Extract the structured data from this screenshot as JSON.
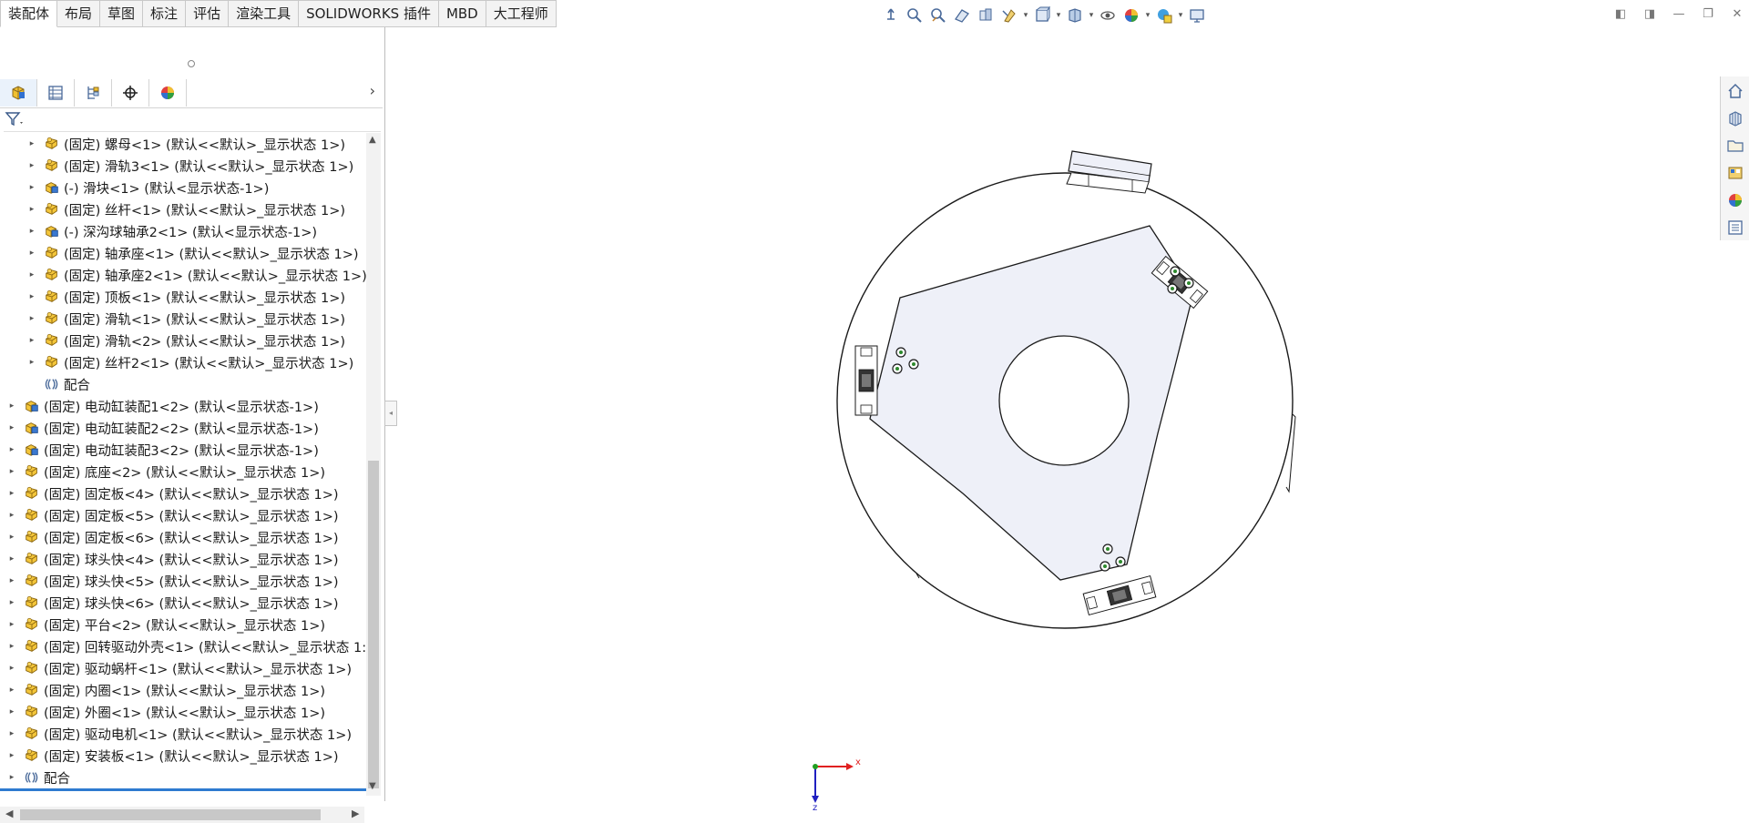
{
  "command_tabs": [
    {
      "label": "装配体",
      "active": true
    },
    {
      "label": "布局",
      "active": false
    },
    {
      "label": "草图",
      "active": false
    },
    {
      "label": "标注",
      "active": false
    },
    {
      "label": "评估",
      "active": false
    },
    {
      "label": "渲染工具",
      "active": false
    },
    {
      "label": "SOLIDWORKS 插件",
      "active": false
    },
    {
      "label": "MBD",
      "active": false
    },
    {
      "label": "大工程师",
      "active": false
    }
  ],
  "headsup_icons": [
    "zoom-to-fit-icon",
    "zoom-to-area-icon",
    "previous-view-icon",
    "section-view-icon",
    "dynamic-annotation-icon",
    "view-orientation-icon",
    "display-style-icon",
    "hide-show-items-icon",
    "edit-appearance-icon",
    "apply-scene-icon",
    "view-settings-icon",
    "display-pane-icon"
  ],
  "feature_manager": {
    "tabs": [
      "feature-manager-tab",
      "property-manager-tab",
      "configuration-manager-tab",
      "dimxpert-manager-tab",
      "display-manager-tab"
    ],
    "tree": [
      {
        "level": 1,
        "icon": "part",
        "text": "(固定) 螺母<1> (默认<<默认>_显示状态 1>)"
      },
      {
        "level": 1,
        "icon": "part",
        "text": "(固定) 滑轨3<1> (默认<<默认>_显示状态 1>)"
      },
      {
        "level": 1,
        "icon": "assembly",
        "text": "(-) 滑块<1> (默认<显示状态-1>)"
      },
      {
        "level": 1,
        "icon": "part",
        "text": "(固定) 丝杆<1> (默认<<默认>_显示状态 1>)"
      },
      {
        "level": 1,
        "icon": "assembly",
        "text": "(-) 深沟球轴承2<1> (默认<显示状态-1>)"
      },
      {
        "level": 1,
        "icon": "part",
        "text": "(固定) 轴承座<1> (默认<<默认>_显示状态 1>)"
      },
      {
        "level": 1,
        "icon": "part",
        "text": "(固定) 轴承座2<1> (默认<<默认>_显示状态 1>)"
      },
      {
        "level": 1,
        "icon": "part",
        "text": "(固定) 顶板<1> (默认<<默认>_显示状态 1>)"
      },
      {
        "level": 1,
        "icon": "part",
        "text": "(固定) 滑轨<1> (默认<<默认>_显示状态 1>)"
      },
      {
        "level": 1,
        "icon": "part",
        "text": "(固定) 滑轨<2> (默认<<默认>_显示状态 1>)"
      },
      {
        "level": 1,
        "icon": "part",
        "text": "(固定) 丝杆2<1> (默认<<默认>_显示状态 1>)"
      },
      {
        "level": 1,
        "icon": "mates",
        "text": "配合",
        "noexp": true
      },
      {
        "level": 0,
        "icon": "assembly",
        "text": "(固定) 电动缸装配1<2> (默认<显示状态-1>)"
      },
      {
        "level": 0,
        "icon": "assembly",
        "text": "(固定) 电动缸装配2<2> (默认<显示状态-1>)"
      },
      {
        "level": 0,
        "icon": "assembly",
        "text": "(固定) 电动缸装配3<2> (默认<显示状态-1>)"
      },
      {
        "level": 0,
        "icon": "part",
        "text": "(固定) 底座<2> (默认<<默认>_显示状态 1>)"
      },
      {
        "level": 0,
        "icon": "part",
        "text": "(固定) 固定板<4> (默认<<默认>_显示状态 1>)"
      },
      {
        "level": 0,
        "icon": "part",
        "text": "(固定) 固定板<5> (默认<<默认>_显示状态 1>)"
      },
      {
        "level": 0,
        "icon": "part",
        "text": "(固定) 固定板<6> (默认<<默认>_显示状态 1>)"
      },
      {
        "level": 0,
        "icon": "part",
        "text": "(固定) 球头快<4> (默认<<默认>_显示状态 1>)"
      },
      {
        "level": 0,
        "icon": "part",
        "text": "(固定) 球头快<5> (默认<<默认>_显示状态 1>)"
      },
      {
        "level": 0,
        "icon": "part",
        "text": "(固定) 球头快<6> (默认<<默认>_显示状态 1>)"
      },
      {
        "level": 0,
        "icon": "part",
        "text": "(固定) 平台<2> (默认<<默认>_显示状态 1>)"
      },
      {
        "level": 0,
        "icon": "part",
        "text": "(固定) 回转驱动外壳<1> (默认<<默认>_显示状态 1:"
      },
      {
        "level": 0,
        "icon": "part",
        "text": "(固定) 驱动蜗杆<1> (默认<<默认>_显示状态 1>)"
      },
      {
        "level": 0,
        "icon": "part",
        "text": "(固定) 内圈<1> (默认<<默认>_显示状态 1>)"
      },
      {
        "level": 0,
        "icon": "part",
        "text": "(固定) 外圈<1> (默认<<默认>_显示状态 1>)"
      },
      {
        "level": 0,
        "icon": "part",
        "text": "(固定) 驱动电机<1> (默认<<默认>_显示状态 1>)"
      },
      {
        "level": 0,
        "icon": "part",
        "text": "(固定) 安装板<1> (默认<<默认>_显示状态 1>)"
      },
      {
        "level": 0,
        "icon": "mates",
        "text": "配合"
      }
    ]
  },
  "task_pane_icons": [
    "solidworks-resources-icon",
    "design-library-icon",
    "file-explorer-icon",
    "view-palette-icon",
    "appearances-scenes-icon",
    "custom-properties-icon"
  ],
  "triad": {
    "x_label": "x",
    "z_label": "z"
  },
  "colors": {
    "plate_fill": "#eef0f8",
    "outline": "#1a1a1a",
    "triad_x": "#e02020",
    "triad_z": "#2020c0",
    "triad_y": "#20a020",
    "bolt": "#2d8a2d"
  }
}
